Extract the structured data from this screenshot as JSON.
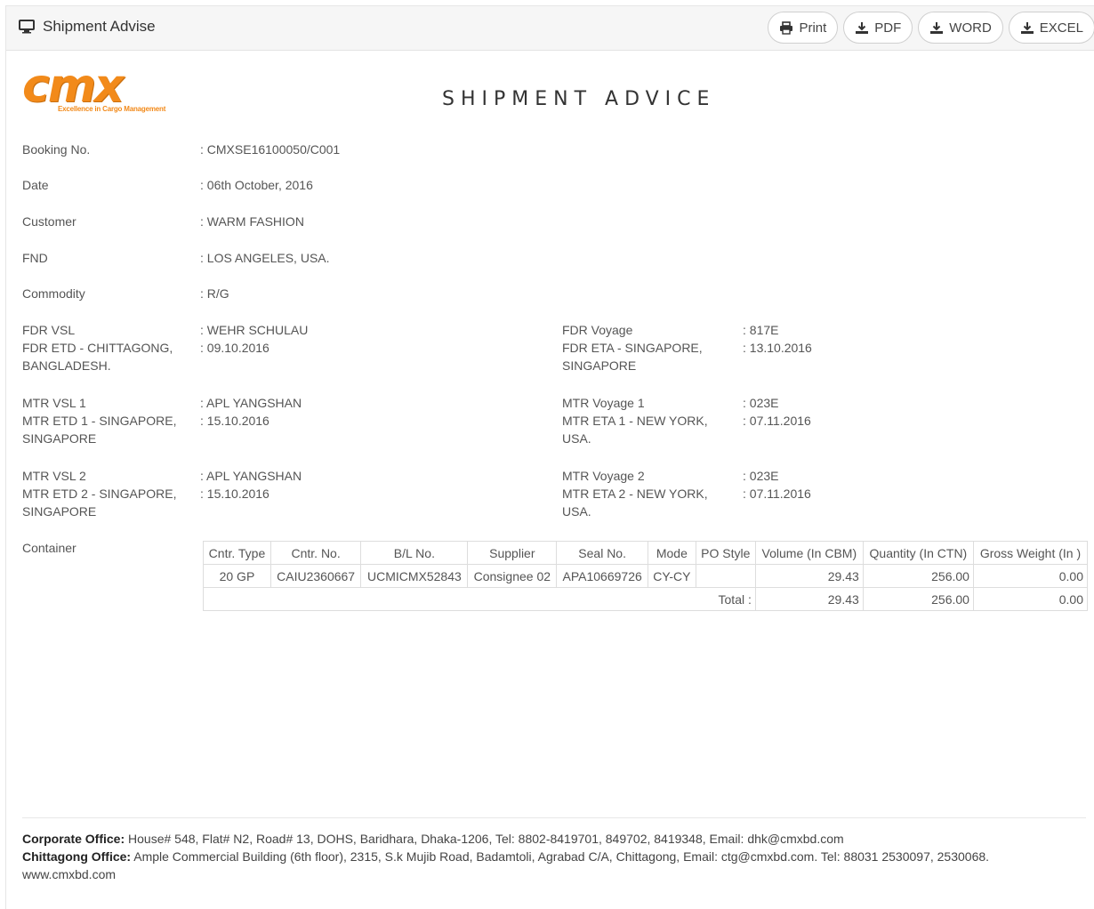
{
  "panel": {
    "title": "Shipment Advise",
    "icon": "monitor-icon",
    "buttons": {
      "print": "Print",
      "pdf": "PDF",
      "word": "WORD",
      "excel": "EXCEL"
    }
  },
  "logo": {
    "text": "cmx",
    "tagline": "Excellence in Cargo Management",
    "color": "#f28a1a"
  },
  "doc_title": "SHIPMENT ADVICE",
  "fields": {
    "booking_no": {
      "label": "Booking No.",
      "value": ": CMXSE16100050/C001"
    },
    "date": {
      "label": "Date",
      "value": ": 06th October, 2016"
    },
    "customer": {
      "label": "Customer",
      "value": ": WARM FASHION"
    },
    "fnd": {
      "label": "FND",
      "value": ": LOS ANGELES, USA."
    },
    "commodity": {
      "label": "Commodity",
      "value": ": R/G"
    }
  },
  "vessels": {
    "fdr_vsl": {
      "label": "FDR VSL",
      "value": ": WEHR SCHULAU"
    },
    "fdr_etd": {
      "label": "FDR ETD - CHITTAGONG,\nBANGLADESH.",
      "value": ": 09.10.2016"
    },
    "fdr_voyage": {
      "label": "FDR Voyage",
      "value": ": 817E"
    },
    "fdr_eta": {
      "label": "FDR ETA - SINGAPORE,\nSINGAPORE",
      "value": ": 13.10.2016"
    },
    "mtr_vsl_1": {
      "label": "MTR VSL 1",
      "value": ": APL YANGSHAN"
    },
    "mtr_etd_1": {
      "label": "MTR ETD 1 - SINGAPORE,\nSINGAPORE",
      "value": ": 15.10.2016"
    },
    "mtr_voyage_1": {
      "label": "MTR Voyage 1",
      "value": ": 023E"
    },
    "mtr_eta_1": {
      "label": "MTR ETA 1 - NEW YORK,\nUSA.",
      "value": ": 07.11.2016"
    },
    "mtr_vsl_2": {
      "label": "MTR VSL 2",
      "value": ": APL YANGSHAN"
    },
    "mtr_etd_2": {
      "label": "MTR ETD 2 - SINGAPORE,\nSINGAPORE",
      "value": ": 15.10.2016"
    },
    "mtr_voyage_2": {
      "label": "MTR Voyage 2",
      "value": ": 023E"
    },
    "mtr_eta_2": {
      "label": "MTR ETA 2 - NEW YORK,\nUSA.",
      "value": ": 07.11.2016"
    }
  },
  "container": {
    "label": "Container",
    "headers": [
      "Cntr. Type",
      "Cntr. No.",
      "B/L No.",
      "Supplier",
      "Seal No.",
      "Mode",
      "PO Style",
      "Volume (In CBM)",
      "Quantity (In CTN)",
      "Gross Weight (In )"
    ],
    "rows": [
      [
        "20 GP",
        "CAIU2360667",
        "UCMICMX52843",
        "Consignee 02",
        "APA10669726",
        "CY-CY",
        "",
        "29.43",
        "256.00",
        "0.00"
      ]
    ],
    "total": {
      "label": "Total :",
      "volume": "29.43",
      "quantity": "256.00",
      "weight": "0.00"
    }
  },
  "footer": {
    "corporate_label": "Corporate Office:",
    "corporate_text": " House# 548, Flat# N2, Road# 13, DOHS, Baridhara, Dhaka-1206, Tel: 8802-8419701, 849702, 8419348, Email: dhk@cmxbd.com",
    "chittagong_label": "Chittagong Office:",
    "chittagong_text": " Ample Commercial Building (6th floor), 2315, S.k Mujib Road, Badamtoli, Agrabad C/A, Chittagong, Email: ctg@cmxbd.com. Tel: 88031 2530097, 2530068.",
    "website": "www.cmxbd.com"
  }
}
